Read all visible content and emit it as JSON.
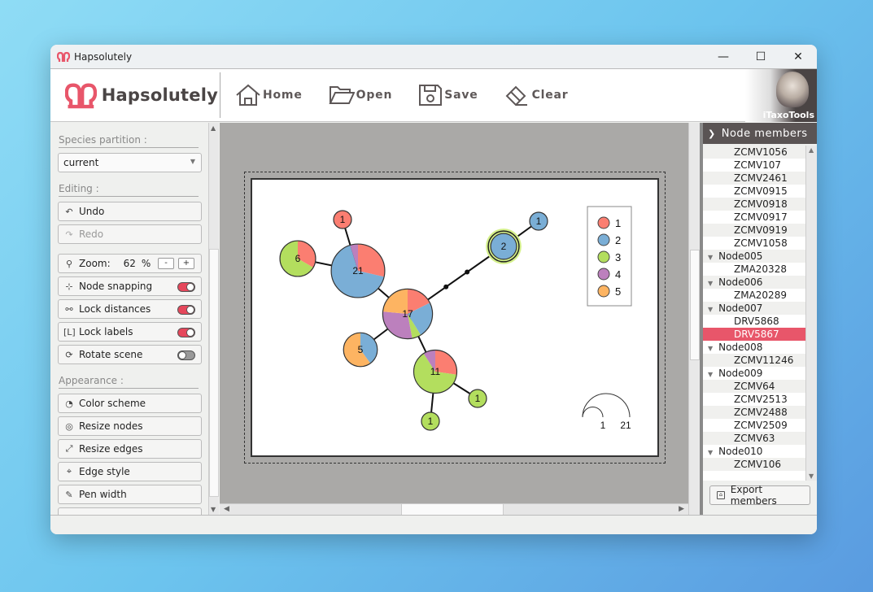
{
  "window": {
    "title": "Hapsolutely",
    "controls": {
      "minimize": "—",
      "maximize": "☐",
      "close": "✕"
    }
  },
  "header": {
    "logo_text": "Hapsolutely",
    "toolbar": [
      {
        "label": "Home",
        "icon": "home-icon"
      },
      {
        "label": "Open",
        "icon": "folder-open-icon"
      },
      {
        "label": "Save",
        "icon": "save-icon"
      },
      {
        "label": "Clear",
        "icon": "eraser-icon"
      }
    ],
    "brand": "iTaxoTools"
  },
  "sidebar": {
    "species_partition_label": "Species partition :",
    "partition_value": "current",
    "editing_label": "Editing :",
    "undo_label": "Undo",
    "redo_label": "Redo",
    "zoom_label": "Zoom:",
    "zoom_value": "62",
    "zoom_unit": "%",
    "zoom_minus": "-",
    "zoom_plus": "+",
    "toggles": [
      {
        "label": "Node snapping",
        "on": true
      },
      {
        "label": "Lock distances",
        "on": true
      },
      {
        "label": "Lock labels",
        "on": true
      },
      {
        "label": "Rotate scene",
        "on": false
      }
    ],
    "appearance_label": "Appearance :",
    "appearance_buttons": [
      {
        "label": "Color scheme"
      },
      {
        "label": "Resize nodes"
      },
      {
        "label": "Resize edges"
      },
      {
        "label": "Edge style"
      },
      {
        "label": "Pen width"
      }
    ]
  },
  "network": {
    "colors": {
      "1": "#fb7e71",
      "2": "#7aaed6",
      "3": "#b3de5e",
      "4": "#bc80bd",
      "5": "#fdb462"
    },
    "legend": [
      "1",
      "2",
      "3",
      "4",
      "5"
    ],
    "scale_labels": [
      "1",
      "21"
    ],
    "nodes": [
      {
        "id": "n1a",
        "label": "1",
        "size": 1,
        "slices": {
          "1": 1
        }
      },
      {
        "id": "n6",
        "label": "6",
        "size": 6,
        "slices": {
          "1": 2,
          "3": 4
        }
      },
      {
        "id": "n21",
        "label": "21",
        "size": 21,
        "slices": {
          "1": 6,
          "4": 1,
          "2": 14
        }
      },
      {
        "id": "n17",
        "label": "17",
        "size": 17,
        "slices": {
          "4": 5,
          "3": 1,
          "5": 4,
          "1": 3,
          "2": 4
        }
      },
      {
        "id": "n5",
        "label": "5",
        "size": 5,
        "slices": {
          "2": 2,
          "5": 3
        }
      },
      {
        "id": "n11",
        "label": "11",
        "size": 11,
        "slices": {
          "1": 3,
          "4": 1,
          "3": 7
        }
      },
      {
        "id": "n1b",
        "label": "1",
        "size": 1,
        "slices": {
          "3": 1
        }
      },
      {
        "id": "n1c",
        "label": "1",
        "size": 1,
        "slices": {
          "3": 1
        }
      },
      {
        "id": "n2",
        "label": "2",
        "size": 2,
        "slices": {
          "2": 2
        },
        "selected": true
      },
      {
        "id": "n1d",
        "label": "1",
        "size": 1,
        "slices": {
          "2": 1
        }
      }
    ],
    "edges": [
      [
        "n1a",
        "n21"
      ],
      [
        "n6",
        "n21"
      ],
      [
        "n21",
        "n17"
      ],
      [
        "n17",
        "n5"
      ],
      [
        "n17",
        "n11"
      ],
      [
        "n11",
        "n1b"
      ],
      [
        "n11",
        "n1c"
      ],
      [
        "n17",
        "n2",
        3
      ],
      [
        "n2",
        "n1d"
      ]
    ]
  },
  "right_panel": {
    "header": "Node members",
    "tree": [
      {
        "type": "leaf",
        "label": "ZCMV1056"
      },
      {
        "type": "leaf",
        "label": "ZCMV107"
      },
      {
        "type": "leaf",
        "label": "ZCMV2461"
      },
      {
        "type": "leaf",
        "label": "ZCMV0915"
      },
      {
        "type": "leaf",
        "label": "ZCMV0918"
      },
      {
        "type": "leaf",
        "label": "ZCMV0917"
      },
      {
        "type": "leaf",
        "label": "ZCMV0919"
      },
      {
        "type": "leaf",
        "label": "ZCMV1058"
      },
      {
        "type": "node",
        "label": "Node005"
      },
      {
        "type": "leaf",
        "label": "ZMA20328"
      },
      {
        "type": "node",
        "label": "Node006"
      },
      {
        "type": "leaf",
        "label": "ZMA20289"
      },
      {
        "type": "node",
        "label": "Node007"
      },
      {
        "type": "leaf",
        "label": "DRV5868"
      },
      {
        "type": "leaf",
        "label": "DRV5867",
        "selected": true
      },
      {
        "type": "node",
        "label": "Node008"
      },
      {
        "type": "leaf",
        "label": "ZCMV11246"
      },
      {
        "type": "node",
        "label": "Node009"
      },
      {
        "type": "leaf",
        "label": "ZCMV64"
      },
      {
        "type": "leaf",
        "label": "ZCMV2513"
      },
      {
        "type": "leaf",
        "label": "ZCMV2488"
      },
      {
        "type": "leaf",
        "label": "ZCMV2509"
      },
      {
        "type": "leaf",
        "label": "ZCMV63"
      },
      {
        "type": "node",
        "label": "Node010"
      },
      {
        "type": "leaf",
        "label": "ZCMV106"
      }
    ],
    "export_label": "Export members"
  }
}
